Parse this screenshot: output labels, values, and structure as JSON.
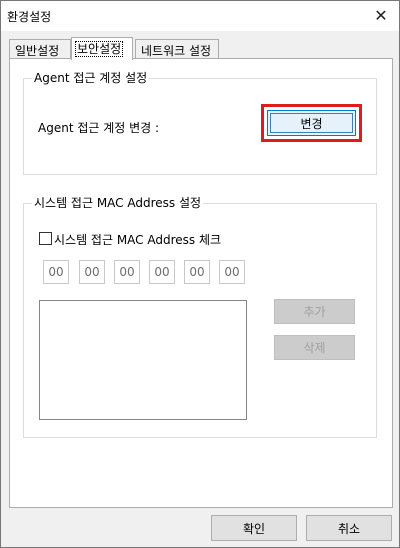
{
  "window": {
    "title": "환경설정",
    "close_symbol": "✕"
  },
  "tabs": [
    {
      "label": "일반설정",
      "active": false
    },
    {
      "label": "보안설정",
      "active": true
    },
    {
      "label": "네트워크 설정",
      "active": false
    }
  ],
  "agent_group": {
    "legend": "Agent 접근 계정 설정",
    "label": "Agent 접근 계정 변경 :",
    "change_button": "변경"
  },
  "mac_group": {
    "legend": "시스템 접근 MAC Address 설정",
    "checkbox_label": "시스템 접근 MAC Address 체크",
    "checkbox_checked": false,
    "mac_fields": [
      "00",
      "00",
      "00",
      "00",
      "00",
      "00"
    ],
    "add_button": "추가",
    "delete_button": "삭제",
    "list_items": []
  },
  "footer": {
    "ok_button": "확인",
    "cancel_button": "취소"
  },
  "colors": {
    "highlight": "#e01b1b",
    "focus_border": "#0078d7"
  }
}
